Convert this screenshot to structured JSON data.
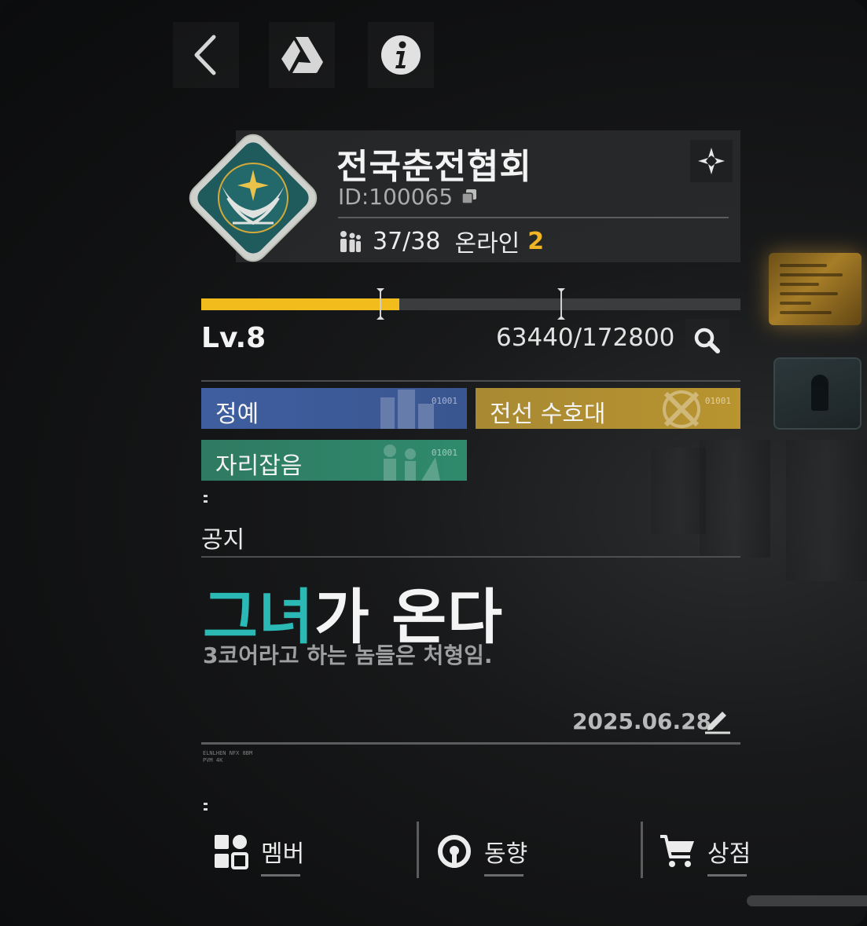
{
  "guild": {
    "name": "전국춘전협회",
    "id_label": "ID:",
    "id_value": "100065",
    "members": "37/38",
    "online_label": "온라인",
    "online_count": "2"
  },
  "level": {
    "label": "Lv.8",
    "xp": "63440/172800",
    "progress_fraction": 0.367
  },
  "tags": [
    {
      "label": "정예",
      "code": "01001",
      "color": "#3f5e9f"
    },
    {
      "label": "전선 수호대",
      "code": "01001",
      "color": "#b0902f"
    },
    {
      "label": "자리잡음",
      "code": "01001",
      "color": "#2f8068"
    }
  ],
  "notice": {
    "title": "공지",
    "headline_accent": "그녀",
    "headline_rest": "가 온다",
    "subtitle": "3코어라고 하는 놈들은 처형임.",
    "date": "2025.06.28",
    "micro": "ELNLHEN NFX 8BM\nPVM 4K"
  },
  "nav": [
    {
      "label": "멤버",
      "icon": "members-grid-icon"
    },
    {
      "label": "동향",
      "icon": "activity-icon"
    },
    {
      "label": "상점",
      "icon": "shop-cart-icon"
    }
  ],
  "colors": {
    "accent_gold": "#f3bc1d",
    "accent_teal": "#2ab9b4",
    "online_orange": "#f0b524"
  }
}
